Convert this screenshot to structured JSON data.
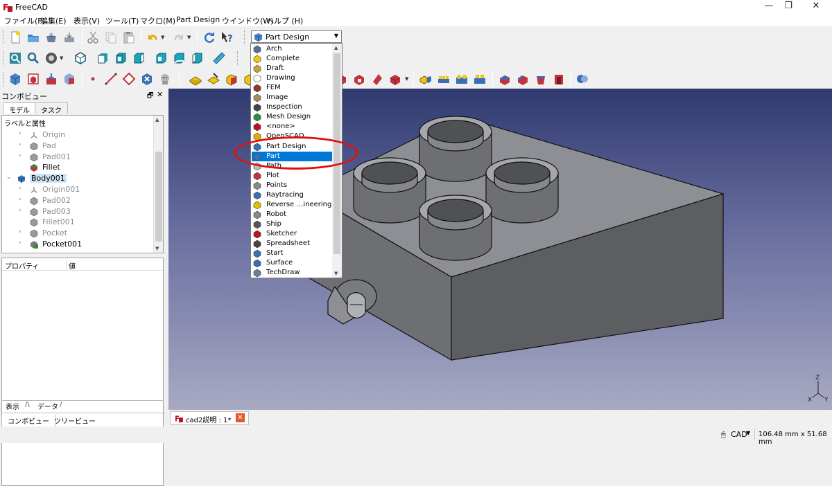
{
  "window": {
    "title": "FreeCAD",
    "buttons": {
      "minimize": "—",
      "maximize": "❐",
      "close": "✕"
    }
  },
  "menu": [
    "ファイル(F)",
    "編集(E)",
    "表示(V)",
    "ツール(T)",
    "マクロ(M)",
    "Part Design",
    "ウインドウ(W)",
    "ヘルプ (H)"
  ],
  "workbench_selector": {
    "selected": "Part Design"
  },
  "workbench_list": [
    "Arch",
    "Complete",
    "Draft",
    "Drawing",
    "FEM",
    "Image",
    "Inspection",
    "Mesh Design",
    "<none>",
    "OpenSCAD",
    "Part Design",
    "Part",
    "Path",
    "Plot",
    "Points",
    "Raytracing",
    "Reverse …ineering",
    "Robot",
    "Ship",
    "Sketcher",
    "Spreadsheet",
    "Start",
    "Surface",
    "TechDraw"
  ],
  "workbench_highlighted": "Part",
  "combo_view": {
    "title": "コンボビュー",
    "tabs": [
      "モデル",
      "タスク"
    ],
    "tree_header": "ラベルと属性",
    "tree": [
      {
        "label": "Origin",
        "indent": 1,
        "icon": "origin",
        "expandable": true,
        "gray": true
      },
      {
        "label": "Pad",
        "indent": 1,
        "icon": "pad",
        "expandable": true,
        "gray": true
      },
      {
        "label": "Pad001",
        "indent": 1,
        "icon": "pad",
        "expandable": true,
        "gray": true
      },
      {
        "label": "Fillet",
        "indent": 1,
        "icon": "fillet",
        "expandable": false,
        "gray": false
      },
      {
        "label": "Body001",
        "indent": 0,
        "icon": "body",
        "expandable": true,
        "expanded": true,
        "gray": false,
        "selected": true
      },
      {
        "label": "Origin001",
        "indent": 1,
        "icon": "origin",
        "expandable": true,
        "gray": true
      },
      {
        "label": "Pad002",
        "indent": 1,
        "icon": "pad",
        "expandable": true,
        "gray": true
      },
      {
        "label": "Pad003",
        "indent": 1,
        "icon": "pad",
        "expandable": true,
        "gray": true
      },
      {
        "label": "Fillet001",
        "indent": 1,
        "icon": "pad",
        "expandable": false,
        "gray": true
      },
      {
        "label": "Pocket",
        "indent": 1,
        "icon": "pad",
        "expandable": true,
        "gray": true
      },
      {
        "label": "Pocket001",
        "indent": 1,
        "icon": "pocket",
        "expandable": true,
        "gray": false
      }
    ],
    "property_headers": [
      "プロパティ",
      "値"
    ],
    "prop_tabs": [
      "表示",
      "データ"
    ],
    "bottom_tabs": [
      "コンボビュー",
      "ツリービュー"
    ]
  },
  "document_tab": {
    "label": "cad2説明 : 1*"
  },
  "status": {
    "nav_style": "CAD",
    "dimensions": "106.48 mm x 51.68 mm"
  },
  "colors": {
    "highlight": "#0078d7",
    "annotation": "#e01010"
  }
}
